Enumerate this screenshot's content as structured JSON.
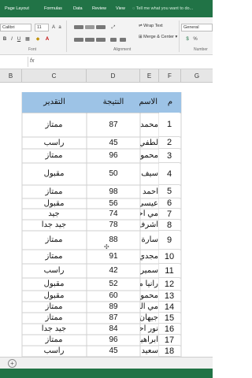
{
  "ribbon_tabs": [
    "Page Layout",
    "Formulas",
    "Data",
    "Review",
    "View"
  ],
  "tell_me": "Tell me what you want to do...",
  "font": {
    "name": "Calibri",
    "size": "11"
  },
  "wrap_text": "Wrap Text",
  "merge_center": "Merge & Center",
  "number_format": "General",
  "groups": {
    "font": "Font",
    "alignment": "Alignment",
    "number": "Number"
  },
  "fx": "fx",
  "columns": [
    "B",
    "C",
    "D",
    "E",
    "F",
    "G"
  ],
  "table": {
    "headers": {
      "grade": "التقدير",
      "score": "النتيجة",
      "name": "الاسم",
      "num": "م"
    },
    "rows": [
      {
        "num": "1",
        "name": "محمد احمد",
        "score": "87",
        "grade": "ممتاز"
      },
      {
        "num": "2",
        "name": "لطفي محمد",
        "score": "45",
        "grade": "راسب"
      },
      {
        "num": "3",
        "name": "محمود سعد",
        "score": "96",
        "grade": "ممتاز"
      },
      {
        "num": "4",
        "name": "سيف احمد",
        "score": "50",
        "grade": "مقبول"
      },
      {
        "num": "5",
        "name": "احمد محمد",
        "score": "98",
        "grade": "ممتاز"
      },
      {
        "num": "6",
        "name": "عيسى السيد",
        "score": "56",
        "grade": "مقبول"
      },
      {
        "num": "7",
        "name": "مي احمد",
        "score": "74",
        "grade": "جيد"
      },
      {
        "num": "8",
        "name": "اشرف محمد",
        "score": "78",
        "grade": "جيد جدا"
      },
      {
        "num": "9",
        "name": "سارة احمد",
        "score": "88",
        "grade": "ممتاز"
      },
      {
        "num": "10",
        "name": "مجدي محمد",
        "score": "91",
        "grade": "ممتاز"
      },
      {
        "num": "11",
        "name": "سمير السيد",
        "score": "42",
        "grade": "راسب"
      },
      {
        "num": "12",
        "name": "رانيا محمد",
        "score": "52",
        "grade": "مقبول"
      },
      {
        "num": "13",
        "name": "محمود علي",
        "score": "60",
        "grade": "مقبول"
      },
      {
        "num": "14",
        "name": "مي السيد",
        "score": "89",
        "grade": "ممتاز"
      },
      {
        "num": "15",
        "name": "جيهان محمد",
        "score": "87",
        "grade": "ممتاز"
      },
      {
        "num": "16",
        "name": "نور احمد",
        "score": "84",
        "grade": "جيد جدا"
      },
      {
        "num": "17",
        "name": "ابراهيم محمد",
        "score": "96",
        "grade": "ممتاز"
      },
      {
        "num": "18",
        "name": "سعيد محمد",
        "score": "45",
        "grade": "راسب"
      }
    ]
  }
}
